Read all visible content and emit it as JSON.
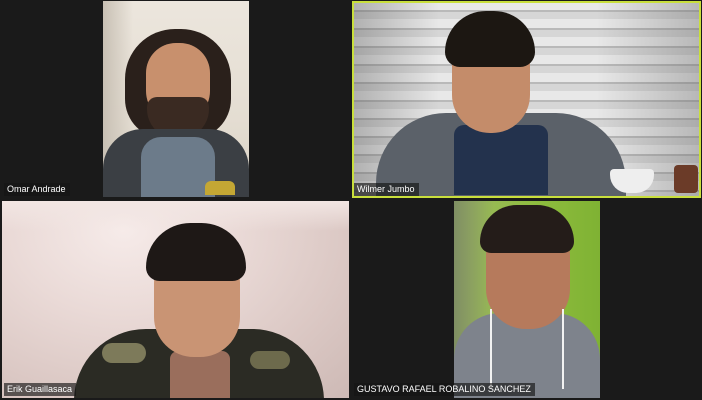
{
  "participants": [
    {
      "name": "Omar Andrade",
      "active_speaker": false
    },
    {
      "name": "Wilmer Jumbo",
      "active_speaker": true
    },
    {
      "name": "Erik Guaillasaca",
      "active_speaker": false
    },
    {
      "name": "GUSTAVO RAFAEL ROBALINO SANCHEZ",
      "active_speaker": false
    }
  ],
  "colors": {
    "background": "#1a1a1a",
    "active_speaker_border": "#c9df3c",
    "name_tag_text": "#ffffff"
  }
}
